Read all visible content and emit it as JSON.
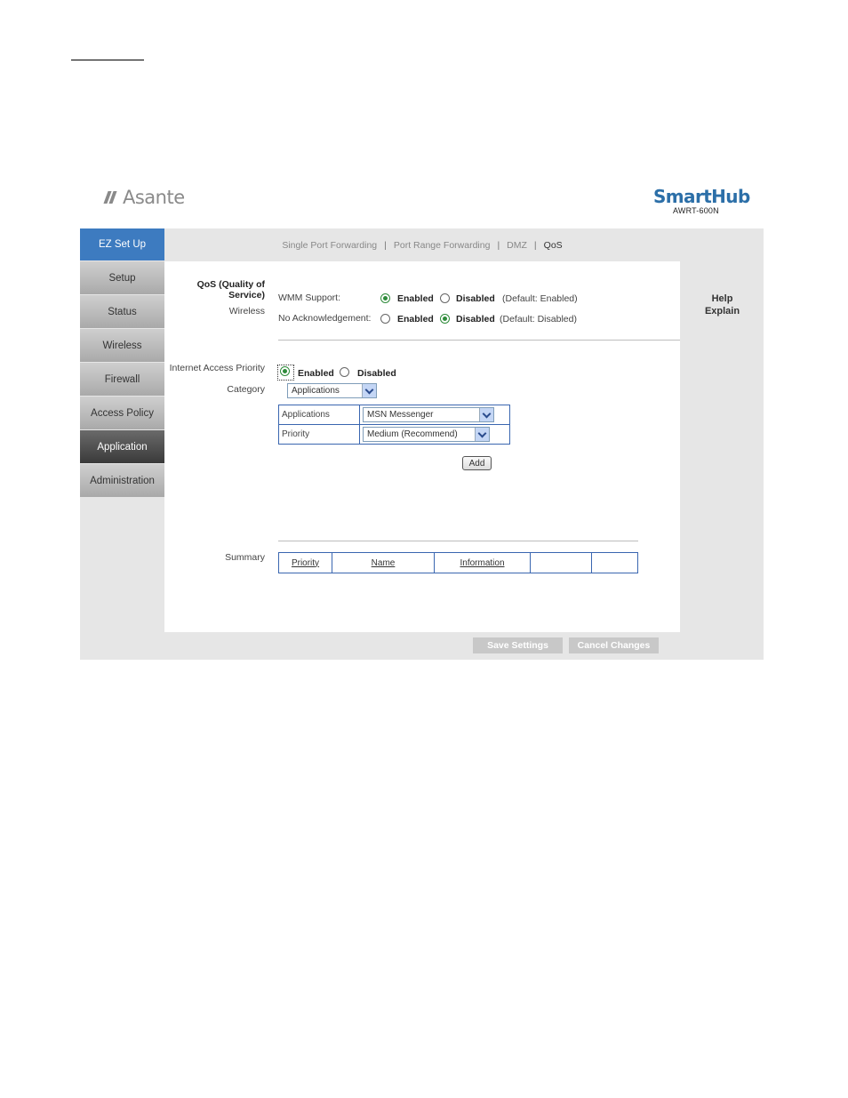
{
  "brand": {
    "left_logo": "Asante",
    "right_logo": "SmartHub",
    "model": "AWRT-600N"
  },
  "nav": [
    {
      "label": "EZ Set Up"
    },
    {
      "label": "Setup"
    },
    {
      "label": "Status"
    },
    {
      "label": "Wireless"
    },
    {
      "label": "Firewall"
    },
    {
      "label": "Access Policy"
    },
    {
      "label": "Application"
    },
    {
      "label": "Administration"
    }
  ],
  "tabs": [
    "Single Port Forwarding",
    "Port Range Forwarding",
    "DMZ",
    "QoS"
  ],
  "qos": {
    "section_title": "QoS (Quality of Service)",
    "wireless_label": "Wireless",
    "wmm_label": "WMM Support:",
    "wmm_enabled": "Enabled",
    "wmm_disabled": "Disabled",
    "wmm_default": "(Default: Enabled)",
    "noack_label": "No Acknowledgement:",
    "noack_enabled": "Enabled",
    "noack_disabled": "Disabled",
    "noack_default": "(Default: Disabled)",
    "iap_label": "Internet Access Priority",
    "iap_enabled": "Enabled",
    "iap_disabled": "Disabled",
    "category_label": "Category",
    "category_value": "Applications",
    "app_row_label": "Applications",
    "app_row_value": "MSN Messenger",
    "priority_row_label": "Priority",
    "priority_row_value": "Medium (Recommend)",
    "add_button": "Add",
    "summary_label": "Summary",
    "summary_headers": [
      "Priority",
      "Name",
      "Information",
      "",
      ""
    ]
  },
  "help": {
    "line1": "Help",
    "line2": "Explain"
  },
  "buttons": {
    "save": "Save Settings",
    "cancel": "Cancel Changes"
  }
}
